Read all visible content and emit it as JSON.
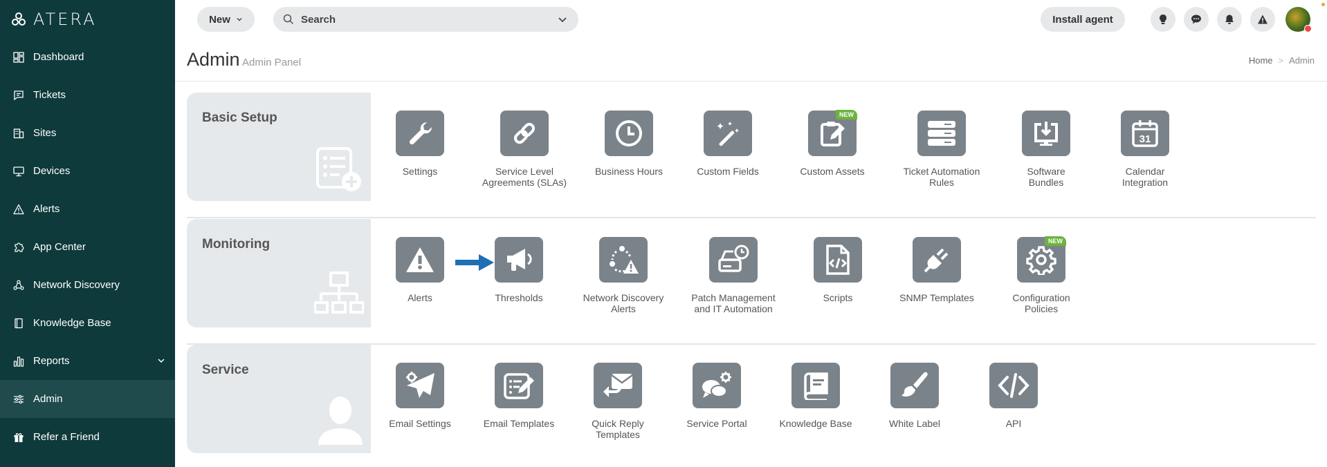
{
  "brand": {
    "name": "ATERA"
  },
  "sidebar": {
    "items": [
      {
        "label": "Dashboard",
        "icon": "dashboard-icon"
      },
      {
        "label": "Tickets",
        "icon": "ticket-icon"
      },
      {
        "label": "Sites",
        "icon": "building-icon"
      },
      {
        "label": "Devices",
        "icon": "monitor-icon"
      },
      {
        "label": "Alerts",
        "icon": "warning-icon"
      },
      {
        "label": "App Center",
        "icon": "puzzle-icon"
      },
      {
        "label": "Network Discovery",
        "icon": "network-icon"
      },
      {
        "label": "Knowledge Base",
        "icon": "book-icon"
      },
      {
        "label": "Reports",
        "icon": "bar-chart-icon"
      },
      {
        "label": "Admin",
        "icon": "sliders-icon"
      },
      {
        "label": "Refer a Friend",
        "icon": "gift-icon"
      }
    ],
    "active": "Admin"
  },
  "topbar": {
    "new_label": "New",
    "search_placeholder": "Search",
    "install_label": "Install agent"
  },
  "page": {
    "title": "Admin",
    "subtitle": "Admin Panel",
    "breadcrumb": [
      "Home",
      "Admin"
    ]
  },
  "sections": [
    {
      "title": "Basic Setup",
      "tiles": [
        {
          "label": "Settings",
          "icon": "wrench-icon"
        },
        {
          "label": "Service Level Agreements (SLAs)",
          "icon": "link-icon"
        },
        {
          "label": "Business Hours",
          "icon": "clock-icon"
        },
        {
          "label": "Custom Fields",
          "icon": "magic-wand-icon"
        },
        {
          "label": "Custom Assets",
          "icon": "clipboard-edit-icon",
          "badge": "NEW"
        },
        {
          "label": "Ticket Automation Rules",
          "icon": "server-icon"
        },
        {
          "label": "Software Bundles",
          "icon": "download-monitor-icon"
        },
        {
          "label": "Calendar Integration",
          "icon": "calendar-icon",
          "calendar_day": "31"
        }
      ]
    },
    {
      "title": "Monitoring",
      "tiles": [
        {
          "label": "Alerts",
          "icon": "warning-icon"
        },
        {
          "label": "Thresholds",
          "icon": "megaphone-icon"
        },
        {
          "label": "Network Discovery Alerts",
          "icon": "network-alert-icon"
        },
        {
          "label": "Patch Management and IT Automation",
          "icon": "drive-clock-icon"
        },
        {
          "label": "Scripts",
          "icon": "code-file-icon"
        },
        {
          "label": "SNMP Templates",
          "icon": "plug-icon"
        },
        {
          "label": "Configuration Policies",
          "icon": "gear-icon",
          "badge": "NEW"
        }
      ]
    },
    {
      "title": "Service",
      "tiles": [
        {
          "label": "Email Settings",
          "icon": "paper-plane-gear-icon"
        },
        {
          "label": "Email Templates",
          "icon": "template-edit-icon"
        },
        {
          "label": "Quick Reply Templates",
          "icon": "envelope-reply-icon"
        },
        {
          "label": "Service Portal",
          "icon": "chat-gear-icon"
        },
        {
          "label": "Knowledge Base",
          "icon": "book-icon"
        },
        {
          "label": "White Label",
          "icon": "paintbrush-icon"
        },
        {
          "label": "API",
          "icon": "code-icon"
        }
      ]
    }
  ]
}
